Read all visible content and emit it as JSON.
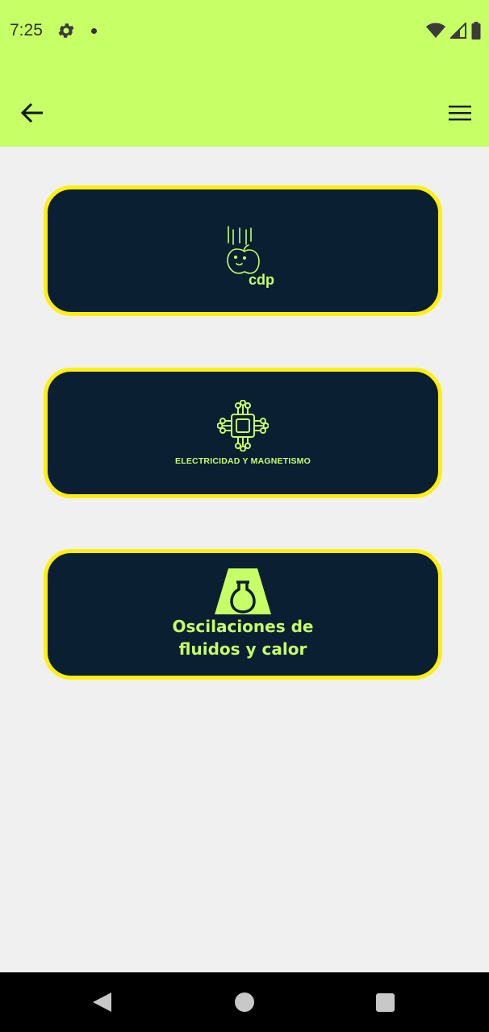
{
  "status_bar": {
    "time": "7:25",
    "icons": [
      "settings-icon",
      "notification-dot",
      "wifi-icon",
      "signal-icon",
      "battery-icon"
    ]
  },
  "app_bar": {
    "back_icon": "arrow-back-icon",
    "menu_icon": "hamburger-menu-icon",
    "background": "#c6ff66"
  },
  "cards": [
    {
      "label": "cdp",
      "icon": "falling-apple-icon"
    },
    {
      "label": "ELECTRICIDAD Y MAGNETISMO",
      "icon": "circuit-chip-icon"
    },
    {
      "label_line1": "Oscilaciones de",
      "label_line2": "fluidos y calor",
      "icon": "flask-icon"
    }
  ],
  "colors": {
    "card_bg": "#0b1f33",
    "card_border": "#ffef11",
    "accent": "#c6ff66",
    "page_bg": "#f0f0f0"
  },
  "nav_bar": {
    "items": [
      "back-triangle",
      "home-circle",
      "recents-square"
    ]
  }
}
